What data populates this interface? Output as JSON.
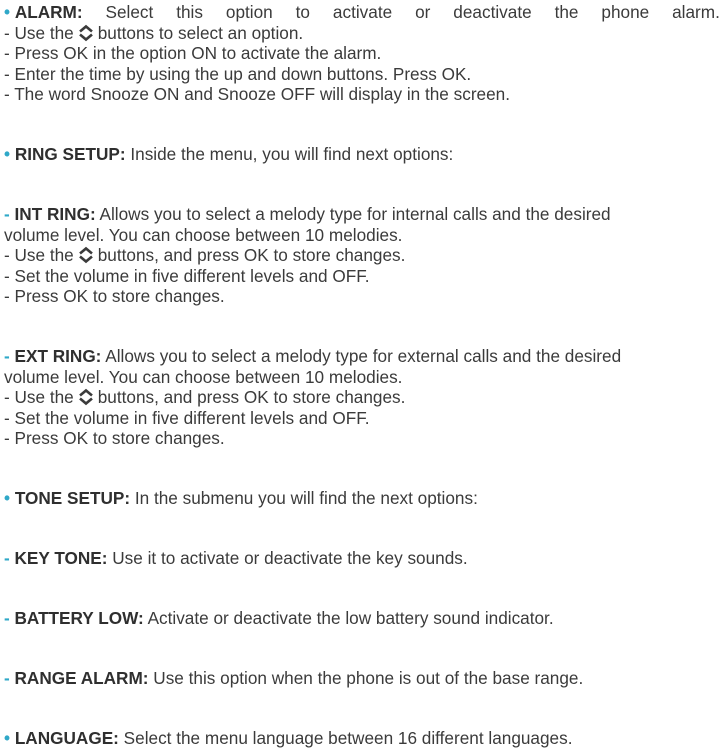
{
  "alarm": {
    "bullet": "•",
    "term": "ALARM:",
    "words": [
      "Select",
      "this",
      "option",
      "to",
      "activate",
      "or",
      "deactivate",
      "the",
      "phone",
      "alarm."
    ],
    "lines": {
      "use_pre": "- Use the",
      "use_post": "buttons to select an option.",
      "press_on": "- Press OK in the option ON to activate the alarm.",
      "enter_time": "- Enter the time by using the up and down buttons. Press OK.",
      "snooze": "- The word Snooze ON and Snooze OFF will display in the screen."
    }
  },
  "ring_setup": {
    "bullet": "•",
    "term": "RING SETUP:",
    "text": "Inside the menu, you will find next options:"
  },
  "int_ring": {
    "dash": "-",
    "term": "INT RING:",
    "line1": "Allows you to select a melody type for internal calls and the desired",
    "line2": "volume level. You can choose between 10 melodies.",
    "use_pre": "- Use the",
    "use_post": "buttons, and press OK to store changes.",
    "volume": "- Set the volume in five different levels and OFF.",
    "store": "- Press OK to store changes."
  },
  "ext_ring": {
    "dash": "-",
    "term": "EXT RING:",
    "line1": "Allows you to select a melody type for external calls and the desired",
    "line2": "volume level. You can choose between 10 melodies.",
    "use_pre": "- Use the",
    "use_post": "buttons, and press OK to store changes.",
    "volume": "- Set the volume in five different levels and OFF.",
    "store": "- Press OK to store changes."
  },
  "tone_setup": {
    "bullet": "•",
    "term": "TONE SETUP:",
    "text": "In the submenu you will find the next options:"
  },
  "key_tone": {
    "dash": "-",
    "term": "KEY TONE:",
    "text": "Use it to activate or deactivate the key sounds."
  },
  "battery_low": {
    "dash": "-",
    "term": "BATTERY LOW:",
    "text": "Activate or deactivate the low battery sound indicator."
  },
  "range_alarm": {
    "dash": "-",
    "term": "RANGE ALARM:",
    "text": "Use this option when the phone is out of the base range."
  },
  "language": {
    "bullet": "•",
    "term": "LANGUAGE:",
    "text": "Select the menu language between 16 different languages."
  },
  "colors": {
    "accent": "#2fa8c8",
    "text": "#3b3b3b"
  },
  "icons": {
    "updown": "up-down-arrows-icon"
  }
}
